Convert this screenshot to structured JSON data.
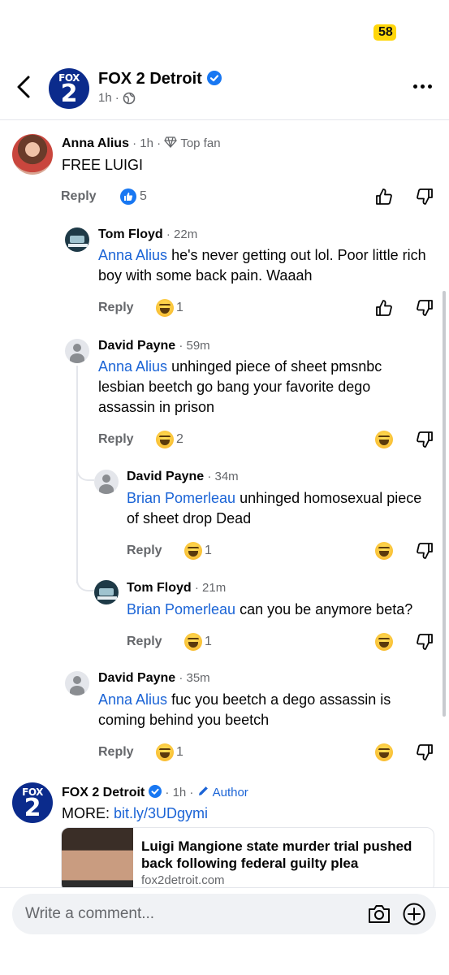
{
  "status_bar": {
    "battery": "58"
  },
  "header": {
    "page_name": "FOX 2 Detroit",
    "logo_top": "FOX",
    "logo_bottom": "2",
    "time": "1h",
    "visibility_icon": "globe-icon"
  },
  "comments": [
    {
      "author": "Anna Alius",
      "meta": " · 1h · ",
      "badge": "Top fan",
      "text": "FREE LUIGI",
      "reply_label": "Reply",
      "reaction": "like",
      "reaction_count": "5"
    },
    {
      "author": "Tom Floyd",
      "meta": " · 22m",
      "mention": "Anna Alius",
      "text": " he's never getting out lol. Poor little rich boy with some back pain. Waaah",
      "reply_label": "Reply",
      "reaction": "haha",
      "reaction_count": "1"
    },
    {
      "author": "David Payne",
      "meta": " · 59m",
      "mention": "Anna Alius",
      "text": " unhinged piece of sheet pmsnbc lesbian beetch go bang your favorite dego assassin in prison",
      "reply_label": "Reply",
      "reaction": "haha",
      "reaction_count": "2"
    },
    {
      "author": "David Payne",
      "meta": " · 34m",
      "mention": "Brian Pomerleau",
      "text": " unhinged homosexual piece of sheet drop Dead",
      "reply_label": "Reply",
      "reaction": "haha",
      "reaction_count": "1"
    },
    {
      "author": "Tom Floyd",
      "meta": " · 21m",
      "mention": "Brian Pomerleau",
      "text": " can you be anymore beta?",
      "reply_label": "Reply",
      "reaction": "haha",
      "reaction_count": "1"
    },
    {
      "author": "David Payne",
      "meta": " · 35m",
      "mention": "Anna Alius",
      "text": " fuc you beetch a dego assassin is coming behind you beetch",
      "reply_label": "Reply",
      "reaction": "haha",
      "reaction_count": "1"
    }
  ],
  "author_comment": {
    "author": "FOX 2 Detroit",
    "meta": " · 1h · ",
    "badge": "Author",
    "text_prefix": "MORE: ",
    "link": "bit.ly/3UDgymi",
    "preview": {
      "title": "Luigi Mangione state murder trial pushed back following federal guilty plea",
      "domain": "fox2detroit.com"
    }
  },
  "composer": {
    "placeholder": "Write a comment..."
  },
  "colors": {
    "link": "#1b64d6",
    "brand": "#0b2b8c",
    "like": "#1877f2",
    "muted": "#65676b"
  }
}
